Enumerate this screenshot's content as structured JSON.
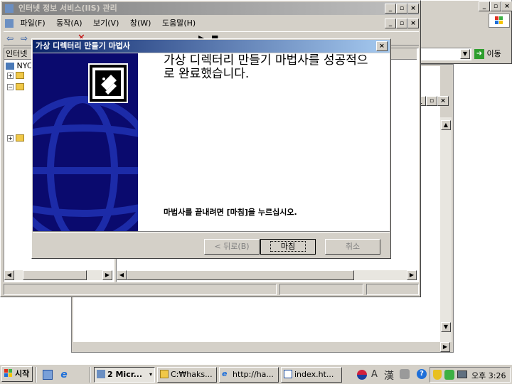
{
  "iis": {
    "title": "인터넷 정보 서비스(IIS) 관리",
    "menu": [
      "파일(F)",
      "동작(A)",
      "보기(V)",
      "창(W)",
      "도움말(H)"
    ],
    "tree_header": "인터넷",
    "tree_root": "NYC"
  },
  "browser": {
    "go_label": "이동"
  },
  "wizard": {
    "title": "가상 디렉터리 만들기 마법사",
    "heading": "가상 디렉터리 만들기 마법사를 성공적으로 완료했습니다.",
    "instruction": "마법사를 끝내려면 [마침]을 누르십시오.",
    "back_label": "< 뒤로(B)",
    "finish_label": "마침",
    "cancel_label": "취소"
  },
  "taskbar": {
    "start_label": "시작",
    "tasks": [
      "2 Micr...",
      "C:₩haks...",
      "http://ha...",
      "index.ht..."
    ],
    "tray_ime": "漢",
    "tray_lang": "A",
    "clock": "오후 3:26"
  },
  "colors": {
    "titlebar_active": "#0a246a",
    "wizard_panel": "#0a0a6e",
    "face": "#d4d0c8"
  }
}
